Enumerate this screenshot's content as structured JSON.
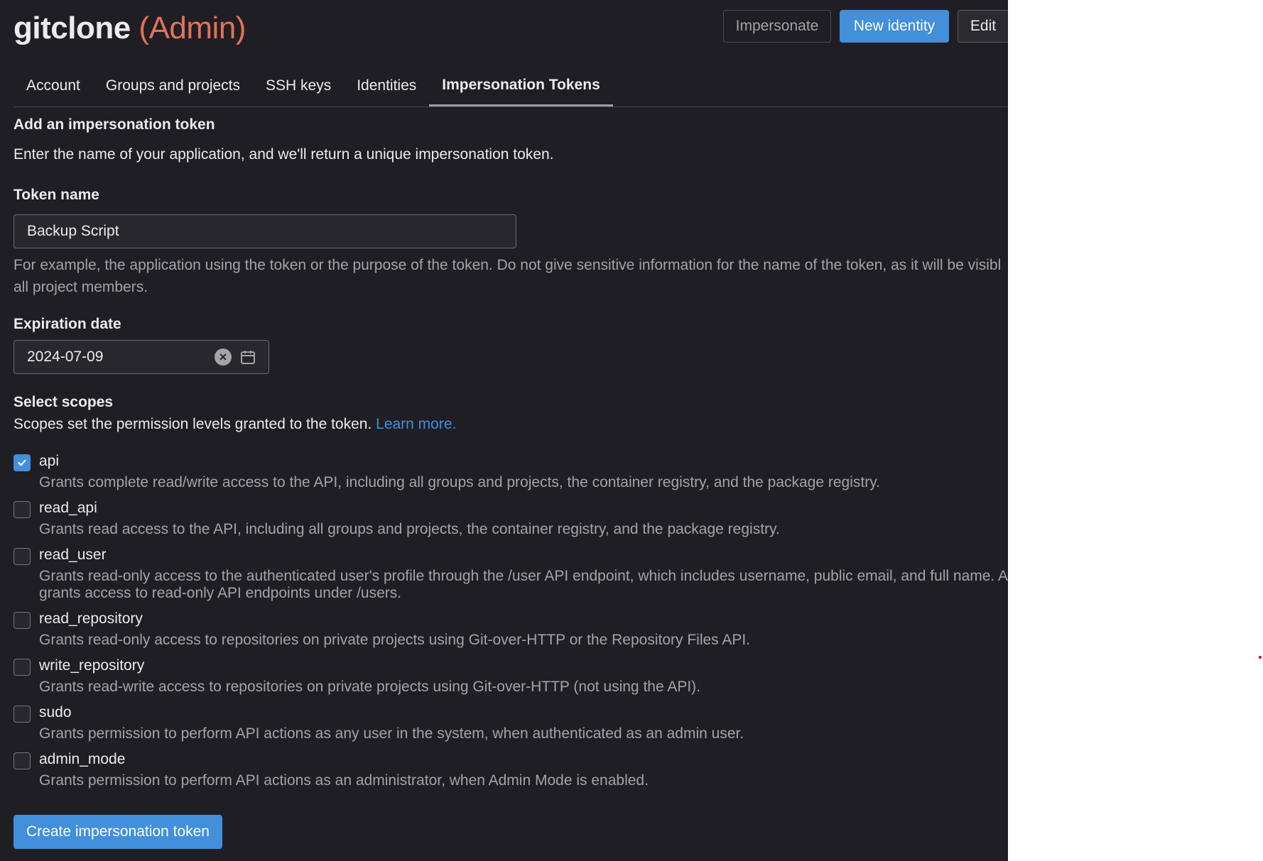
{
  "header": {
    "title_name": "gitclone",
    "title_role": "(Admin)",
    "buttons": {
      "impersonate": "Impersonate",
      "new_identity": "New identity",
      "edit": "Edit"
    }
  },
  "tabs": [
    {
      "label": "Account",
      "active": false
    },
    {
      "label": "Groups and projects",
      "active": false
    },
    {
      "label": "SSH keys",
      "active": false
    },
    {
      "label": "Identities",
      "active": false
    },
    {
      "label": "Impersonation Tokens",
      "active": true
    }
  ],
  "form": {
    "section_title": "Add an impersonation token",
    "intro": "Enter the name of your application, and we'll return a unique impersonation token.",
    "token_name_label": "Token name",
    "token_name_value": "Backup Script",
    "token_help_line1": "For example, the application using the token or the purpose of the token. Do not give sensitive information for the name of the token, as it will be visibl",
    "token_help_line2": "all project members.",
    "expiration_label": "Expiration date",
    "expiration_value": "2024-07-09",
    "scopes_title": "Select scopes",
    "scopes_desc": "Scopes set the permission levels granted to the token.",
    "learn_more": "Learn more.",
    "submit_label": "Create impersonation token"
  },
  "scopes": [
    {
      "name": "api",
      "checked": true,
      "desc": "Grants complete read/write access to the API, including all groups and projects, the container registry, and the package registry."
    },
    {
      "name": "read_api",
      "checked": false,
      "desc": "Grants read access to the API, including all groups and projects, the container registry, and the package registry."
    },
    {
      "name": "read_user",
      "checked": false,
      "desc": "Grants read-only access to the authenticated user's profile through the /user API endpoint, which includes username, public email, and full name. Al",
      "desc2": "grants access to read-only API endpoints under /users."
    },
    {
      "name": "read_repository",
      "checked": false,
      "desc": "Grants read-only access to repositories on private projects using Git-over-HTTP or the Repository Files API."
    },
    {
      "name": "write_repository",
      "checked": false,
      "desc": "Grants read-write access to repositories on private projects using Git-over-HTTP (not using the API)."
    },
    {
      "name": "sudo",
      "checked": false,
      "desc": "Grants permission to perform API actions as any user in the system, when authenticated as an admin user."
    },
    {
      "name": "admin_mode",
      "checked": false,
      "desc": "Grants permission to perform API actions as an administrator, when Admin Mode is enabled."
    }
  ],
  "colors": {
    "accent": "#428fdc",
    "admin_text": "#e0735a",
    "background": "#1f1e24"
  }
}
